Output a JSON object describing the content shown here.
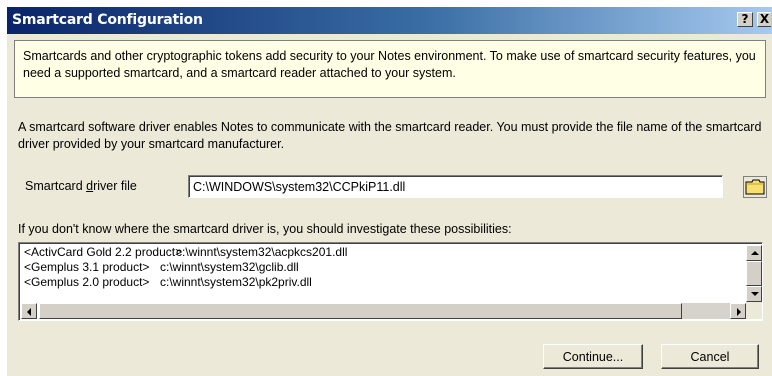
{
  "window": {
    "title": "Smartcard Configuration",
    "help_label": "?",
    "close_label": "X"
  },
  "intro": {
    "text": "Smartcards and other cryptographic tokens add security to your Notes environment. To make use of smartcard security features, you need a supported smartcard, and a smartcard reader attached to your system."
  },
  "driver": {
    "description": "A smartcard software driver enables Notes to communicate with the smartcard reader.  You must provide the file name of the smartcard driver provided by your smartcard manufacturer.",
    "label_before": "Smartcard ",
    "label_mnemonic": "d",
    "label_after": "river file",
    "value": "C:\\WINDOWS\\system32\\CCPkiP11.dll"
  },
  "possibilities": {
    "label": "If you don't know where the smartcard driver is, you should investigate these possibilities:",
    "items": [
      {
        "product": "<ActivCard Gold 2.2 product>",
        "path": "c:\\winnt\\system32\\acpkcs201.dll"
      },
      {
        "product": "<Gemplus 3.1 product>",
        "path": "c:\\winnt\\system32\\gclib.dll"
      },
      {
        "product": "<Gemplus 2.0 product>",
        "path": "c:\\winnt\\system32\\pk2priv.dll"
      }
    ]
  },
  "buttons": {
    "continue_label": "Continue...",
    "cancel_label": "Cancel"
  },
  "colors": {
    "title_bar_start": "#0a246a",
    "dialog_face": "#ece9d8",
    "info_background": "#ffffe5",
    "folder_icon": "#f8e070"
  },
  "icons": {
    "browse": "folder-icon"
  }
}
